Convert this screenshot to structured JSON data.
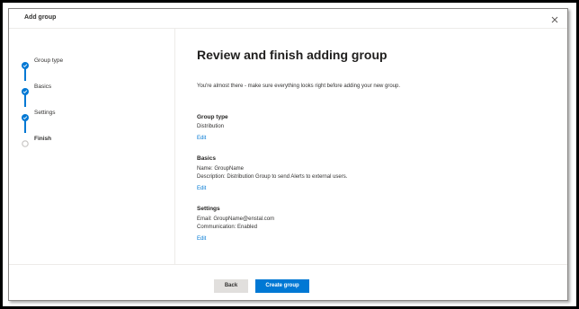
{
  "window": {
    "title": "Add group"
  },
  "wizard": {
    "steps": [
      {
        "label": "Group type",
        "state": "completed"
      },
      {
        "label": "Basics",
        "state": "completed"
      },
      {
        "label": "Settings",
        "state": "completed"
      },
      {
        "label": "Finish",
        "state": "current"
      }
    ]
  },
  "main": {
    "title": "Review and finish adding group",
    "intro": "You're almost there - make sure everything looks right before adding your new group.",
    "sections": [
      {
        "heading": "Group type",
        "lines": [
          "Distribution"
        ],
        "edit": "Edit"
      },
      {
        "heading": "Basics",
        "lines": [
          "Name: GroupName",
          "Description: Distribution Group to send Alerts to external users."
        ],
        "edit": "Edit"
      },
      {
        "heading": "Settings",
        "lines": [
          "Email: GroupName@enstal.com",
          "Communication: Enabled"
        ],
        "edit": "Edit"
      }
    ]
  },
  "footer": {
    "back_label": "Back",
    "create_label": "Create group"
  },
  "colors": {
    "accent": "#0078d4",
    "secondary_button": "#e1dfdd",
    "step_pending": "#c8c6c4"
  },
  "icons": {
    "step_completed": "check-circle-icon",
    "step_current": "circle-icon",
    "close": "close-icon"
  }
}
